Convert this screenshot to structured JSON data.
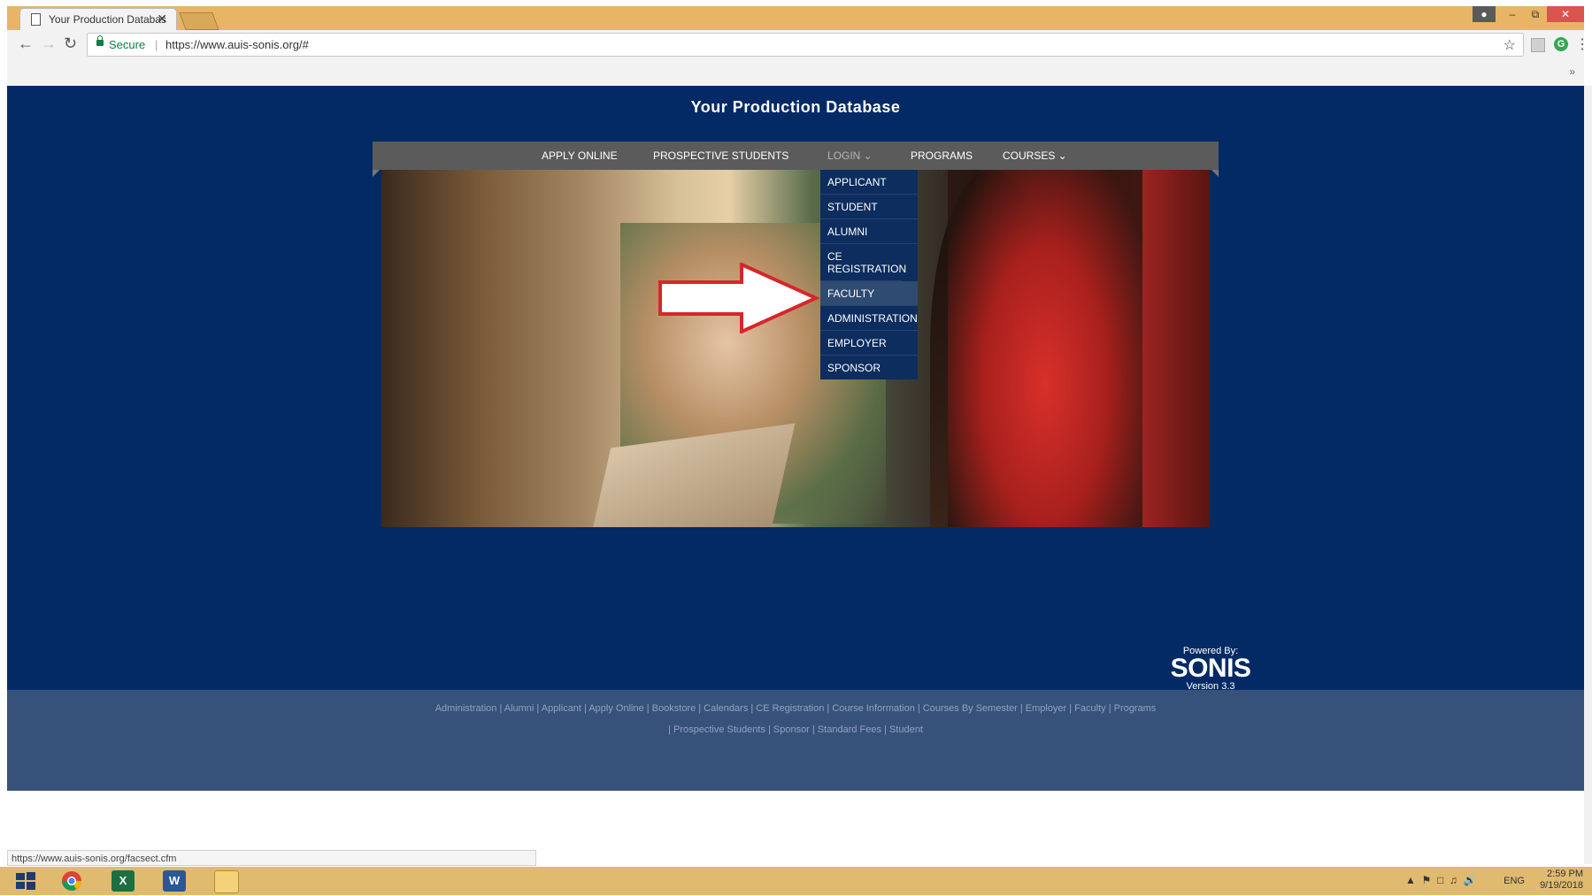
{
  "browser": {
    "tab_title": "Your Production Databas",
    "tab_close": "✕",
    "secure_label": "Secure",
    "url": "https://www.auis-sonis.org/#",
    "status_url": "https://www.auis-sonis.org/facsect.cfm",
    "bookmarks_more": "»"
  },
  "page": {
    "title": "Your Production Database",
    "nav": [
      {
        "label": "APPLY ONLINE"
      },
      {
        "label": "PROSPECTIVE STUDENTS"
      },
      {
        "label": "LOGIN ⌄"
      },
      {
        "label": "PROGRAMS"
      },
      {
        "label": "COURSES ⌄"
      }
    ],
    "login_menu": [
      {
        "label": "APPLICANT"
      },
      {
        "label": "STUDENT"
      },
      {
        "label": "ALUMNI"
      },
      {
        "label": "CE REGISTRATION"
      },
      {
        "label": "FACULTY"
      },
      {
        "label": "ADMINISTRATION"
      },
      {
        "label": "EMPLOYER"
      },
      {
        "label": "SPONSOR"
      }
    ],
    "powered_by": "Powered By:",
    "brand": "SONIS",
    "version": "Version 3.3",
    "footer_row1": "Administration | Alumni | Applicant | Apply Online | Bookstore | Calendars | CE Registration | Course Information | Courses By Semester | Employer | Faculty | Programs",
    "footer_row2": "| Prospective Students | Sponsor | Standard Fees | Student"
  },
  "taskbar": {
    "time": "2:59 PM",
    "date": "9/19/2018",
    "lang": "ENG"
  },
  "colors": {
    "page_bg": "#042a66",
    "navbar_bg": "#5b5b5b",
    "dropdown_bg": "#0d2d5e",
    "footer_bg": "#37527a",
    "arrow_stroke": "#d7262b"
  }
}
